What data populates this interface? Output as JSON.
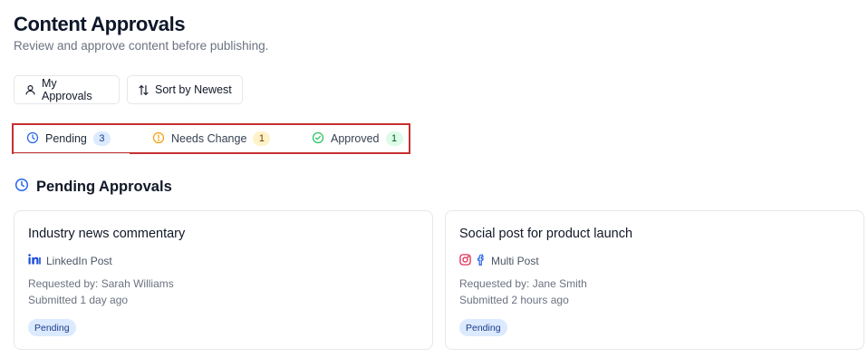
{
  "header": {
    "title": "Content Approvals",
    "subtitle": "Review and approve content before publishing."
  },
  "toolbar": {
    "my_approvals_label": "My Approvals",
    "sort_label": "Sort by Newest"
  },
  "tabs": [
    {
      "label": "Pending",
      "count": "3",
      "icon": "clock-icon",
      "color": "#2563eb"
    },
    {
      "label": "Needs Change",
      "count": "1",
      "icon": "alert-circle-icon",
      "color": "#f59e0b"
    },
    {
      "label": "Approved",
      "count": "1",
      "icon": "check-circle-icon",
      "color": "#22c55e"
    }
  ],
  "section": {
    "title": "Pending Approvals",
    "icon": "clock-icon"
  },
  "cards": [
    {
      "title": "Industry news commentary",
      "platform": "LinkedIn Post",
      "platform_icons": [
        "linkedin-icon"
      ],
      "requested_by": "Requested by: Sarah Williams",
      "submitted": "Submitted 1 day ago",
      "status": "Pending"
    },
    {
      "title": "Social post for product launch",
      "platform": "Multi Post",
      "platform_icons": [
        "instagram-icon",
        "facebook-icon"
      ],
      "requested_by": "Requested by: Jane Smith",
      "submitted": "Submitted 2 hours ago",
      "status": "Pending"
    }
  ],
  "colors": {
    "accent": "#2563eb",
    "highlight_border": "#c62f2f",
    "linkedin": "#1d4ed8",
    "instagram": "#e11d48",
    "facebook": "#2563eb"
  }
}
